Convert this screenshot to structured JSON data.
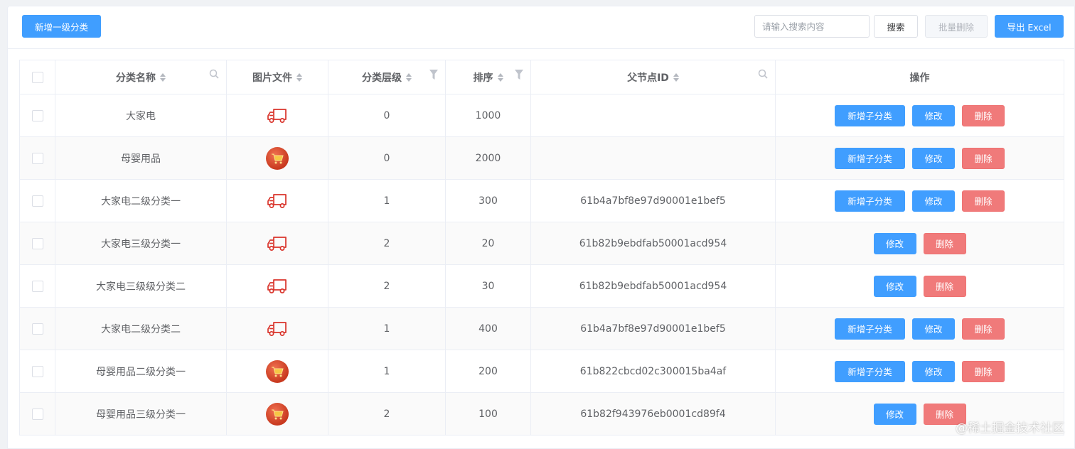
{
  "toolbar": {
    "add_top_label": "新增一级分类",
    "search_placeholder": "请输入搜索内容",
    "search_label": "搜索",
    "batch_delete_label": "批量删除",
    "export_label": "导出 Excel"
  },
  "table": {
    "headers": {
      "name": "分类名称",
      "image": "图片文件",
      "level": "分类层级",
      "sort": "排序",
      "parent_id": "父节点ID",
      "actions": "操作"
    },
    "rows": [
      {
        "name": "大家电",
        "image": "truck-icon",
        "level": "0",
        "sort": "1000",
        "parent_id": "",
        "can_add_child": true
      },
      {
        "name": "母婴用品",
        "image": "cart-icon",
        "level": "0",
        "sort": "2000",
        "parent_id": "",
        "can_add_child": true
      },
      {
        "name": "大家电二级分类一",
        "image": "truck-icon",
        "level": "1",
        "sort": "300",
        "parent_id": "61b4a7bf8e97d90001e1bef5",
        "can_add_child": true
      },
      {
        "name": "大家电三级分类一",
        "image": "truck-icon",
        "level": "2",
        "sort": "20",
        "parent_id": "61b82b9ebdfab50001acd954",
        "can_add_child": false
      },
      {
        "name": "大家电三级级分类二",
        "image": "truck-icon",
        "level": "2",
        "sort": "30",
        "parent_id": "61b82b9ebdfab50001acd954",
        "can_add_child": false
      },
      {
        "name": "大家电二级分类二",
        "image": "truck-icon",
        "level": "1",
        "sort": "400",
        "parent_id": "61b4a7bf8e97d90001e1bef5",
        "can_add_child": true
      },
      {
        "name": "母婴用品二级分类一",
        "image": "cart-icon",
        "level": "1",
        "sort": "200",
        "parent_id": "61b822cbcd02c300015ba4af",
        "can_add_child": true
      },
      {
        "name": "母婴用品三级分类一",
        "image": "cart-icon",
        "level": "2",
        "sort": "100",
        "parent_id": "61b82f943976eb0001cd89f4",
        "can_add_child": false
      }
    ],
    "action_labels": {
      "add_child": "新增子分类",
      "edit": "修改",
      "delete": "删除"
    }
  },
  "watermark": "@稀土掘金技术社区",
  "colors": {
    "primary": "#409eff",
    "danger": "#f07a7a",
    "icon_red": "#d9342b"
  }
}
